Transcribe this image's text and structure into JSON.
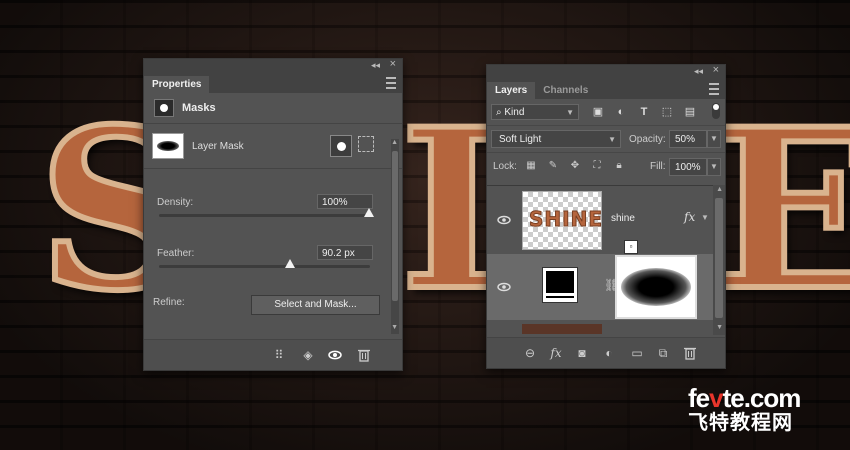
{
  "background": {
    "letters": [
      "S",
      "I",
      "E"
    ]
  },
  "properties": {
    "tab": "Properties",
    "section": "Masks",
    "mask_label": "Layer Mask",
    "density_label": "Density:",
    "density_value": "100%",
    "density_fraction": 1.0,
    "feather_label": "Feather:",
    "feather_value": "90.2 px",
    "feather_fraction": 0.6,
    "refine_label": "Refine:",
    "select_mask_label": "Select and Mask..."
  },
  "layers": {
    "tabs": [
      "Layers",
      "Channels"
    ],
    "filter_kind": "Kind",
    "blend_mode": "Soft Light",
    "opacity_label": "Opacity:",
    "opacity_value": "50%",
    "lock_label": "Lock:",
    "fill_label": "Fill:",
    "fill_value": "100%",
    "rows": [
      {
        "name": "shine",
        "thumb_text": "SHINE",
        "fx": "fx"
      },
      {
        "name": ""
      }
    ]
  },
  "watermark": {
    "line1_a": "fe",
    "line1_b": "v",
    "line1_c": "te.com",
    "line2": "飞特教程网"
  },
  "colors": {
    "panel_bg": "#535353",
    "panel_dark": "#424242",
    "copper": "#b5653d",
    "watermark_red": "#e8352b"
  }
}
